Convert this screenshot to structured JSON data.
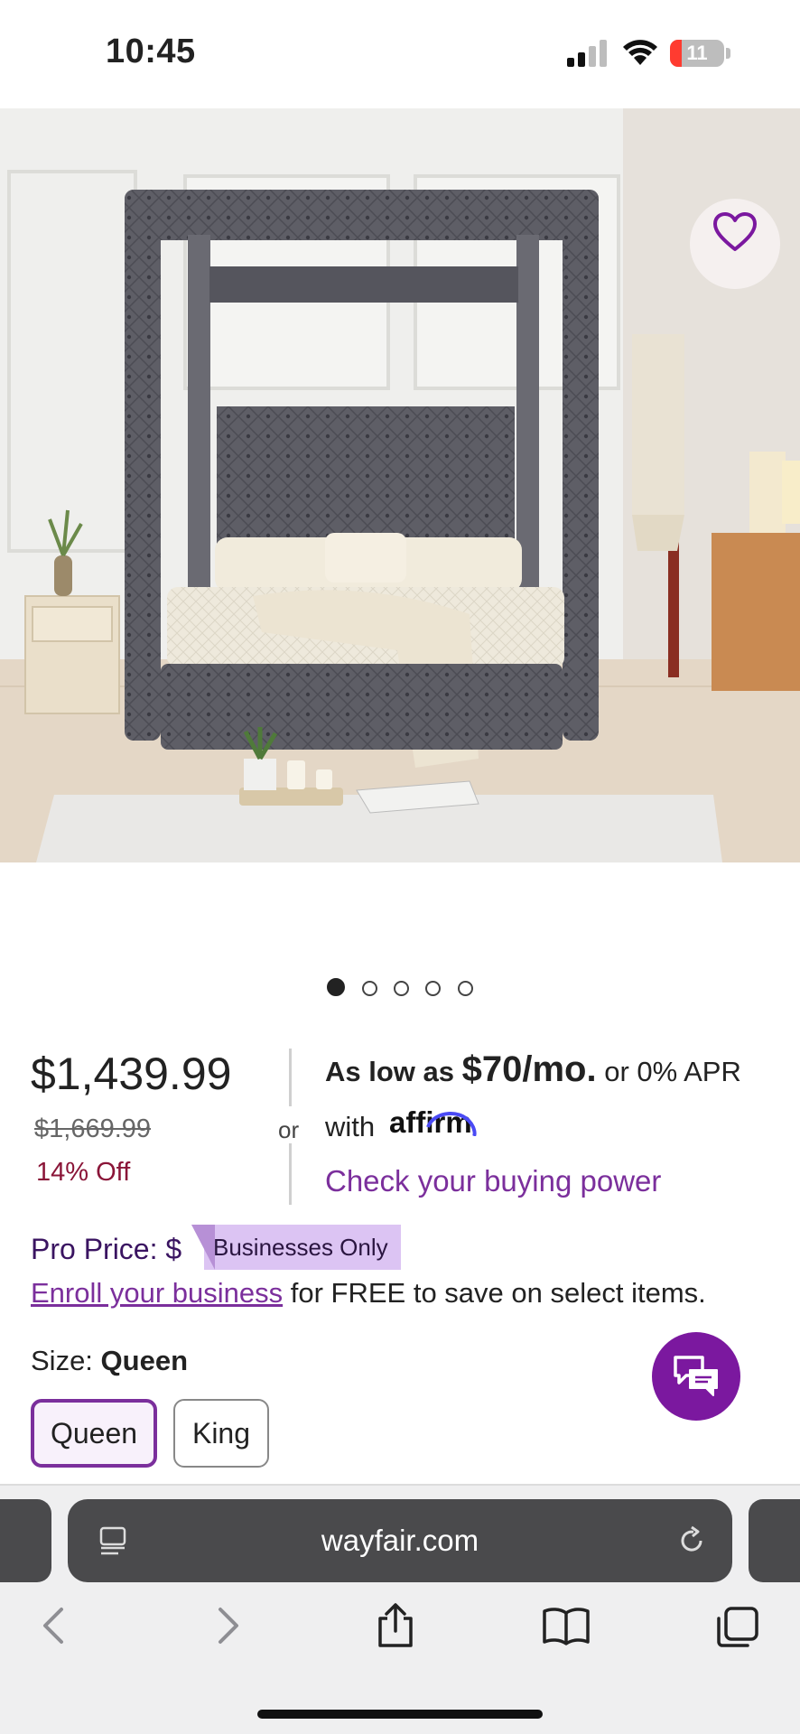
{
  "status_bar": {
    "time": "10:45",
    "battery": "11",
    "battery_level": 0.11
  },
  "product": {
    "price": "$1,439.99",
    "original_price": "$1,669.99",
    "discount": "14% Off",
    "image_count": 5,
    "active_image": 1
  },
  "financing": {
    "prefix": "As low as",
    "monthly": "$70/mo.",
    "suffix": "or 0% APR",
    "with": "with",
    "provider": "affirm",
    "link": "Check your buying power",
    "or": "or"
  },
  "pro_price": {
    "label": "Pro Price:",
    "masked_value": "$",
    "badge": "Businesses Only",
    "enroll_link": "Enroll your business",
    "enroll_text": "for FREE to save on select items."
  },
  "size": {
    "label": "Size:",
    "selected": "Queen",
    "options": [
      "Queen",
      "King"
    ]
  },
  "browser": {
    "url": "wayfair.com"
  },
  "colors": {
    "accent": "#7b2f9c",
    "discount": "#8a1538",
    "chat": "#7b189f"
  },
  "icons": [
    "heart-icon",
    "chat-icon",
    "reader-icon",
    "reload-icon",
    "back-icon",
    "forward-icon",
    "share-icon",
    "bookmarks-icon",
    "tabs-icon"
  ]
}
